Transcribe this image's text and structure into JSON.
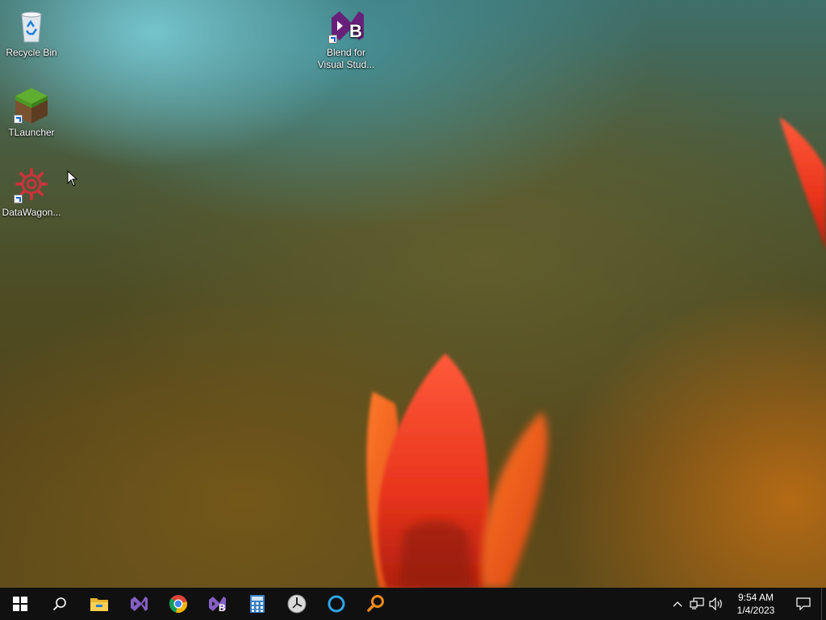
{
  "desktop": {
    "icons": [
      {
        "label": "Recycle Bin",
        "icon": "recycle-bin-icon"
      },
      {
        "label": "TLauncher",
        "icon": "minecraft-grass-block-icon"
      },
      {
        "label": "DataWagon...",
        "icon": "red-gear-icon"
      },
      {
        "label": "Blend for Visual Stud...",
        "icon": "blend-visual-studio-icon"
      }
    ]
  },
  "taskbar": {
    "pinned": [
      {
        "icon": "windows-start-icon"
      },
      {
        "icon": "search-icon"
      },
      {
        "icon": "file-explorer-icon"
      },
      {
        "icon": "visual-studio-icon"
      },
      {
        "icon": "chrome-icon"
      },
      {
        "icon": "blend-visual-studio-icon"
      },
      {
        "icon": "calculator-icon"
      },
      {
        "icon": "clock-icon"
      },
      {
        "icon": "cortana-ring-icon"
      },
      {
        "icon": "orange-search-tool-icon"
      }
    ],
    "tray": {
      "time": "9:54 AM",
      "date": "1/4/2023"
    }
  },
  "colors": {
    "taskbar_bg": "#101010",
    "vs_purple": "#68217a",
    "tulip_red": "#e8341c"
  }
}
